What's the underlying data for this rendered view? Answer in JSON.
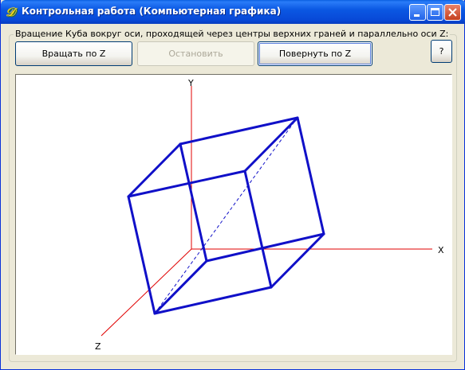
{
  "window": {
    "title": "Контрольная работа (Компьютерная графика)",
    "titlebar_color": "#0b58e3"
  },
  "icons": {
    "app": "delphi-app-icon",
    "minimize": "minimize-icon",
    "maximize": "maximize-icon",
    "close": "close-icon"
  },
  "group": {
    "label": "Вращение Куба вокруг оси, проходящей через центры верхних граней и параллельно оси Z:"
  },
  "toolbar": {
    "rotate_label": "Вращать по Z",
    "stop_label": "Остановить",
    "stop_enabled": false,
    "turn_label": "Повернуть по Z",
    "help_label": "?"
  },
  "scene": {
    "axis_x_label": "X",
    "axis_y_label": "Y",
    "axis_z_label": "Z",
    "axis_color": "#e00000",
    "cube_color": "#1010c8",
    "rotation_axis_style": "dashed"
  }
}
